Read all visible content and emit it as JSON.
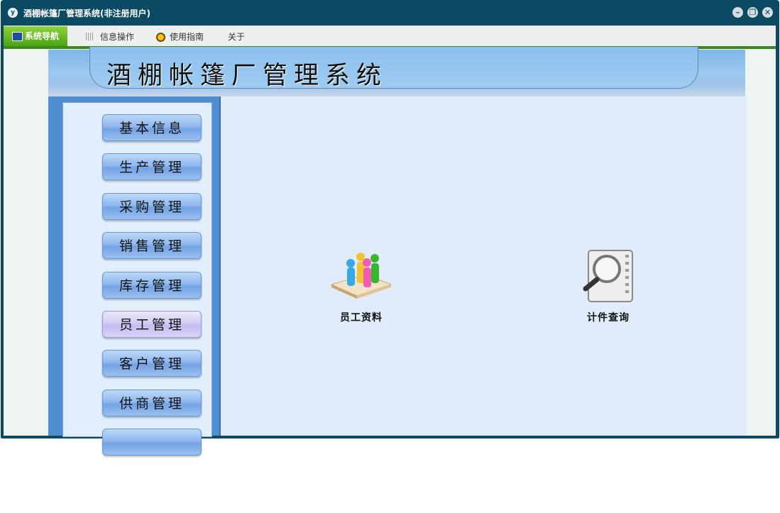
{
  "window": {
    "title": "酒棚帐篷厂管理系统(非注册用户)",
    "app_icon_text": "y",
    "controls": {
      "minimize": "–",
      "restore": "❐",
      "close": "✕"
    }
  },
  "menubar": {
    "items": [
      {
        "label": "系统导航",
        "icon": "monitor-icon",
        "active": true
      },
      {
        "label": "信息操作",
        "icon": "grid-icon",
        "active": false
      },
      {
        "label": "使用指南",
        "icon": "clock-icon",
        "active": false
      },
      {
        "label": "关于",
        "icon": "",
        "active": false
      }
    ]
  },
  "header": {
    "title": "酒棚帐篷厂管理系统"
  },
  "sidebar": {
    "items": [
      {
        "label": "基本信息"
      },
      {
        "label": "生产管理"
      },
      {
        "label": "采购管理"
      },
      {
        "label": "销售管理"
      },
      {
        "label": "库存管理"
      },
      {
        "label": "员工管理",
        "selected": true
      },
      {
        "label": "客户管理"
      },
      {
        "label": "供商管理"
      }
    ]
  },
  "main": {
    "tiles": [
      {
        "label": "员工资料",
        "icon": "staff-people-icon"
      },
      {
        "label": "计件查询",
        "icon": "search-document-icon"
      }
    ]
  },
  "colors": {
    "accent_green": "#4aa413",
    "title_bar": "#0b4a62",
    "selected_nav": "#c3bcf0"
  }
}
